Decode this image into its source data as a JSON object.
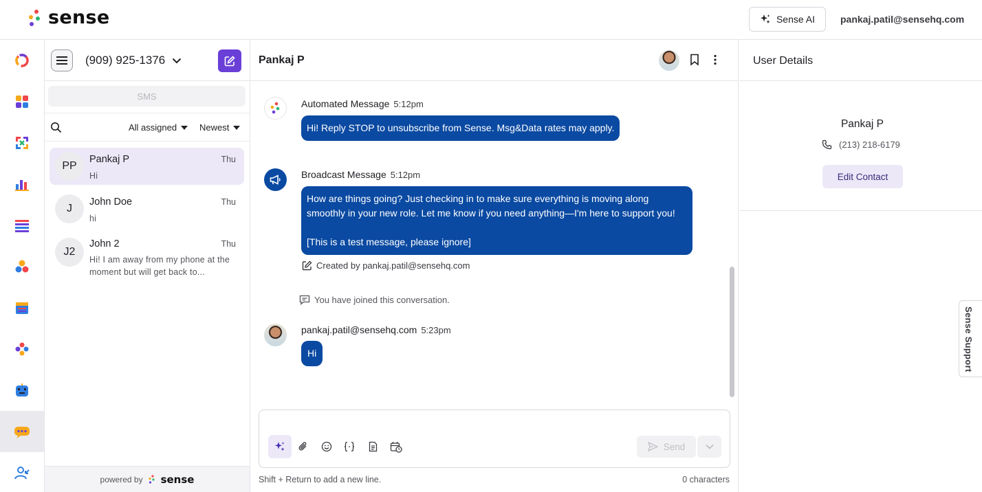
{
  "header": {
    "logo_text": "sense",
    "sense_ai_label": "Sense AI",
    "user_email": "pankaj.patil@sensehq.com"
  },
  "rail": {
    "items": [
      "dashboard-icon",
      "apps-grid-icon",
      "workflows-icon",
      "analytics-icon",
      "lists-icon",
      "audiences-icon",
      "calendar-icon",
      "referrals-icon",
      "bot-icon",
      "messaging-icon",
      "contacts-icon"
    ],
    "active_item": "messaging-icon"
  },
  "conversations": {
    "phone_number": "(909) 925-1376",
    "channel_tab": "SMS",
    "filter_assigned": "All assigned",
    "filter_sort": "Newest",
    "items": [
      {
        "initials": "PP",
        "name": "Pankaj P",
        "day": "Thu",
        "preview": "Hi"
      },
      {
        "initials": "J",
        "name": "John Doe",
        "day": "Thu",
        "preview": "hi"
      },
      {
        "initials": "J2",
        "name": "John 2",
        "day": "Thu",
        "preview": "Hi! I am away from my phone at the moment but will get back to..."
      }
    ],
    "powered_by": "powered by",
    "powered_brand": "sense"
  },
  "chat": {
    "title": "Pankaj P",
    "messages": [
      {
        "sender": "Automated Message",
        "time": "5:12pm",
        "text": "Hi! Reply STOP to unsubscribe from Sense. Msg&Data rates may apply."
      },
      {
        "sender": "Broadcast Message",
        "time": "5:12pm",
        "text_line1": "How are things going? Just checking in to make sure everything is moving along",
        "text_line2": "smoothly in your new role. Let me know if you need anything—I'm here to support you!",
        "text_line3": "[This is a test message, please ignore]",
        "created_by": "Created by pankaj.patil@sensehq.com"
      },
      {
        "system": "You have joined this conversation."
      },
      {
        "sender": "pankaj.patil@sensehq.com",
        "time": "5:23pm",
        "text": "Hi"
      }
    ],
    "send_label": "Send",
    "hint": "Shift + Return to add a new line.",
    "char_count": "0 characters"
  },
  "details": {
    "title": "User Details",
    "contact_name": "Pankaj P",
    "contact_phone": "(213) 218-6179",
    "edit_label": "Edit Contact",
    "support_label": "Sense Support"
  },
  "colors": {
    "accent": "#6a3fd8",
    "bubble": "#0b4aa2",
    "active_row": "#ece8f8"
  }
}
